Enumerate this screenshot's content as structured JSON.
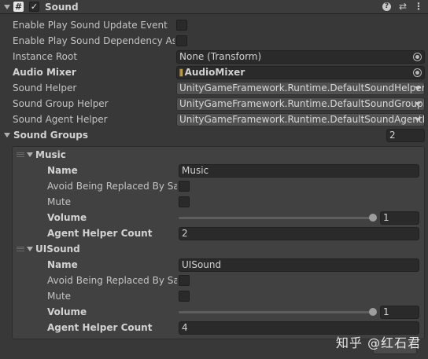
{
  "header": {
    "title": "Sound",
    "component_icon": "script-hash-icon",
    "enabled": true
  },
  "fields": {
    "enable_play_sound_update_event": "Enable Play Sound Update Event",
    "enable_play_sound_dependency_asset": "Enable Play Sound Dependency Asset",
    "instance_root": {
      "label": "Instance Root",
      "value": "None (Transform)"
    },
    "audio_mixer": {
      "label": "Audio Mixer",
      "value": "AudioMixer"
    },
    "sound_helper": {
      "label": "Sound Helper",
      "value": "UnityGameFramework.Runtime.DefaultSoundHelper"
    },
    "sound_group_helper": {
      "label": "Sound Group Helper",
      "value": "UnityGameFramework.Runtime.DefaultSoundGroupHelper"
    },
    "sound_agent_helper": {
      "label": "Sound Agent Helper",
      "value": "UnityGameFramework.Runtime.DefaultSoundAgentHelper"
    }
  },
  "sound_groups": {
    "label": "Sound Groups",
    "count": "2",
    "groups": [
      {
        "title": "Music",
        "name_label": "Name",
        "name_value": "Music",
        "avoid_label": "Avoid Being Replaced By Same Priority",
        "mute_label": "Mute",
        "volume_label": "Volume",
        "volume_value": "1",
        "volume_level": 1,
        "agent_label": "Agent Helper Count",
        "agent_value": "2"
      },
      {
        "title": "UISound",
        "name_label": "Name",
        "name_value": "UISound",
        "avoid_label": "Avoid Being Replaced By Same Priority",
        "mute_label": "Mute",
        "volume_label": "Volume",
        "volume_value": "1",
        "volume_level": 1,
        "agent_label": "Agent Helper Count",
        "agent_value": "4"
      }
    ]
  },
  "watermark": {
    "site": "知乎",
    "author": "@红石君"
  }
}
